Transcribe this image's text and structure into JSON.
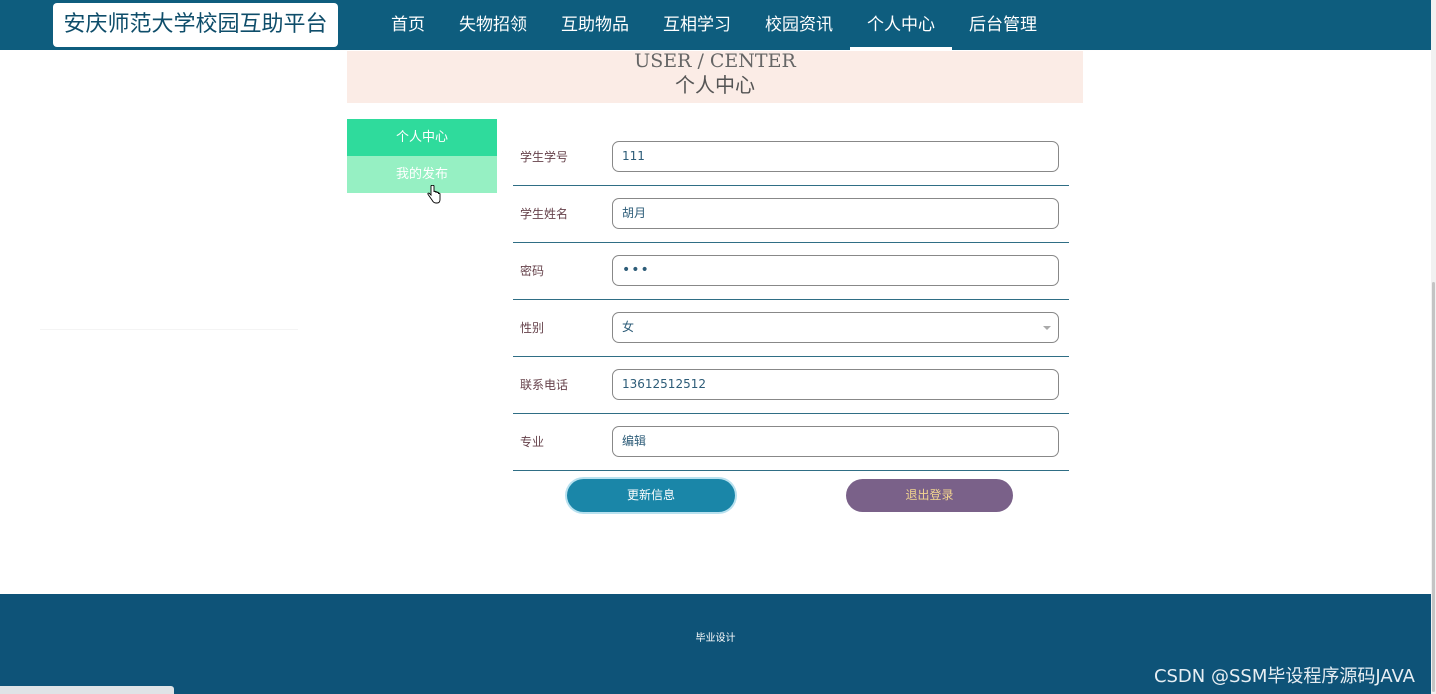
{
  "header": {
    "logo": "安庆师范大学校园互助平台",
    "nav": [
      "首页",
      "失物招领",
      "互助物品",
      "互相学习",
      "校园资讯",
      "个人中心",
      "后台管理"
    ],
    "active_nav": "个人中心"
  },
  "banner": {
    "en": "USER / CENTER",
    "cn": "个人中心"
  },
  "side_menu": {
    "items": [
      "个人中心",
      "我的发布"
    ]
  },
  "form": {
    "fields": [
      {
        "label": "学生学号",
        "value": "111"
      },
      {
        "label": "学生姓名",
        "value": "胡月"
      },
      {
        "label": "密码",
        "value": "•••"
      },
      {
        "label": "性别",
        "value": "女"
      },
      {
        "label": "联系电话",
        "value": "13612512512"
      },
      {
        "label": "专业",
        "value": "编辑"
      }
    ],
    "update_button": "更新信息",
    "logout_button": "退出登录"
  },
  "footer": {
    "text": "毕业设计",
    "watermark": "CSDN @SSM毕设程序源码JAVA"
  },
  "colors": {
    "header_bg": "#0e5d7e",
    "side_active": "#2fdb9c",
    "side_inactive": "#96f0c3",
    "update_btn": "#1a86a8",
    "logout_btn": "#7a6189",
    "footer_bg": "#0e5378"
  }
}
